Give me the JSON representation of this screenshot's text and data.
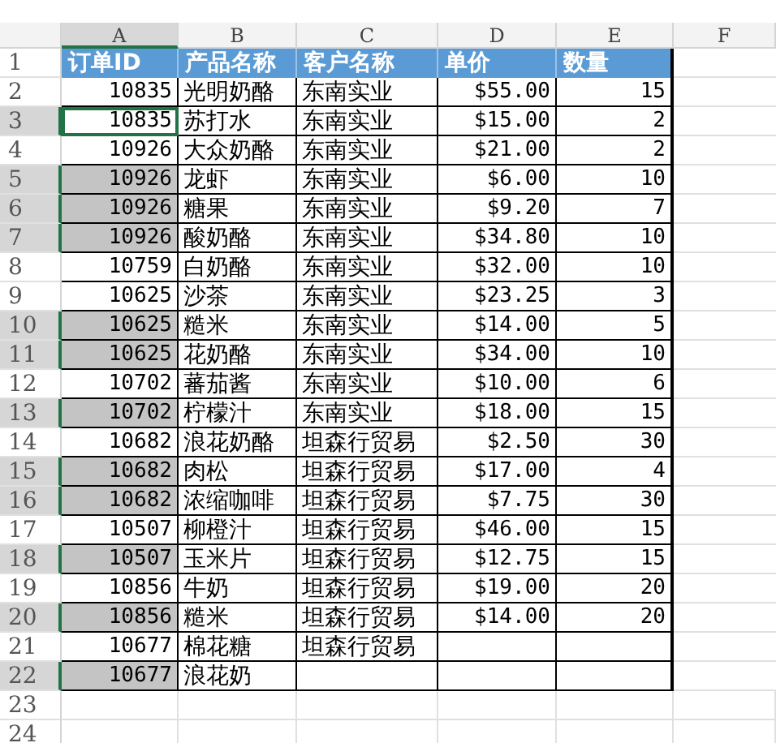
{
  "columns": [
    {
      "label": "A",
      "selected": true
    },
    {
      "label": "B",
      "selected": false
    },
    {
      "label": "C",
      "selected": false
    },
    {
      "label": "D",
      "selected": false
    },
    {
      "label": "E",
      "selected": false
    },
    {
      "label": "F",
      "selected": false
    }
  ],
  "header_row": {
    "number": "1",
    "cells": [
      "订单ID",
      "产品名称",
      "客户名称",
      "单价",
      "数量"
    ]
  },
  "rows": [
    {
      "number": "2",
      "selected": false,
      "active": false,
      "cells": [
        "10835",
        "光明奶酪",
        "东南实业",
        "$55.00",
        "15"
      ]
    },
    {
      "number": "3",
      "selected": true,
      "active": true,
      "cells": [
        "10835",
        "苏打水",
        "东南实业",
        "$15.00",
        "2"
      ]
    },
    {
      "number": "4",
      "selected": false,
      "active": false,
      "cells": [
        "10926",
        "大众奶酪",
        "东南实业",
        "$21.00",
        "2"
      ]
    },
    {
      "number": "5",
      "selected": true,
      "active": false,
      "cells": [
        "10926",
        "龙虾",
        "东南实业",
        "$6.00",
        "10"
      ]
    },
    {
      "number": "6",
      "selected": true,
      "active": false,
      "cells": [
        "10926",
        "糖果",
        "东南实业",
        "$9.20",
        "7"
      ]
    },
    {
      "number": "7",
      "selected": true,
      "active": false,
      "cells": [
        "10926",
        "酸奶酪",
        "东南实业",
        "$34.80",
        "10"
      ]
    },
    {
      "number": "8",
      "selected": false,
      "active": false,
      "cells": [
        "10759",
        "白奶酪",
        "东南实业",
        "$32.00",
        "10"
      ]
    },
    {
      "number": "9",
      "selected": false,
      "active": false,
      "cells": [
        "10625",
        "沙茶",
        "东南实业",
        "$23.25",
        "3"
      ]
    },
    {
      "number": "10",
      "selected": true,
      "active": false,
      "cells": [
        "10625",
        "糙米",
        "东南实业",
        "$14.00",
        "5"
      ]
    },
    {
      "number": "11",
      "selected": true,
      "active": false,
      "cells": [
        "10625",
        "花奶酪",
        "东南实业",
        "$34.00",
        "10"
      ]
    },
    {
      "number": "12",
      "selected": false,
      "active": false,
      "cells": [
        "10702",
        "蕃茄酱",
        "东南实业",
        "$10.00",
        "6"
      ]
    },
    {
      "number": "13",
      "selected": true,
      "active": false,
      "cells": [
        "10702",
        "柠檬汁",
        "东南实业",
        "$18.00",
        "15"
      ]
    },
    {
      "number": "14",
      "selected": false,
      "active": false,
      "cells": [
        "10682",
        "浪花奶酪",
        "坦森行贸易",
        "$2.50",
        "30"
      ]
    },
    {
      "number": "15",
      "selected": true,
      "active": false,
      "cells": [
        "10682",
        "肉松",
        "坦森行贸易",
        "$17.00",
        "4"
      ]
    },
    {
      "number": "16",
      "selected": true,
      "active": false,
      "cells": [
        "10682",
        "浓缩咖啡",
        "坦森行贸易",
        "$7.75",
        "30"
      ]
    },
    {
      "number": "17",
      "selected": false,
      "active": false,
      "cells": [
        "10507",
        "柳橙汁",
        "坦森行贸易",
        "$46.00",
        "15"
      ]
    },
    {
      "number": "18",
      "selected": true,
      "active": false,
      "cells": [
        "10507",
        "玉米片",
        "坦森行贸易",
        "$12.75",
        "15"
      ]
    },
    {
      "number": "19",
      "selected": false,
      "active": false,
      "cells": [
        "10856",
        "牛奶",
        "坦森行贸易",
        "$19.00",
        "20"
      ]
    },
    {
      "number": "20",
      "selected": true,
      "active": false,
      "cells": [
        "10856",
        "糙米",
        "坦森行贸易",
        "$14.00",
        "20"
      ]
    },
    {
      "number": "21",
      "selected": false,
      "active": false,
      "cells": [
        "10677",
        "棉花糖",
        "坦森行贸易",
        null,
        null
      ]
    },
    {
      "number": "22",
      "selected": true,
      "active": false,
      "cells": [
        "10677",
        "浪花奶",
        null,
        null,
        null
      ]
    }
  ],
  "empty_rows": [
    {
      "number": "23"
    },
    {
      "number": "24"
    }
  ]
}
